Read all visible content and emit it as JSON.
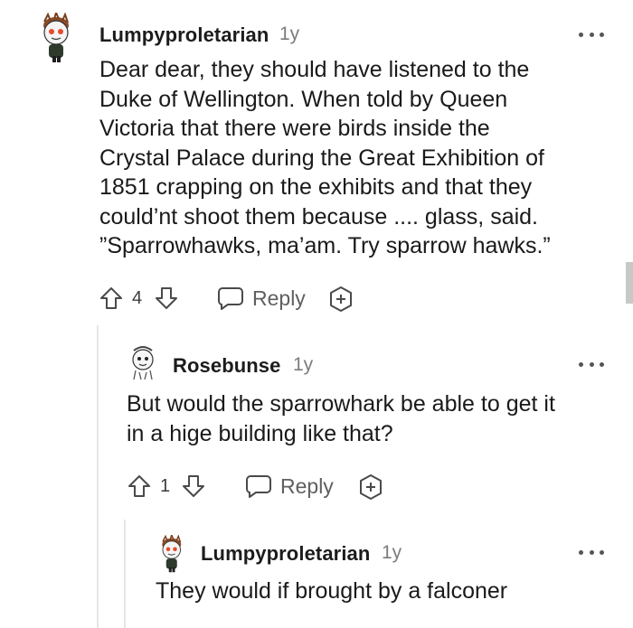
{
  "comments": [
    {
      "username": "Lumpyproletarian",
      "age": "1y",
      "body": "Dear dear, they should have listened to the\nDuke of Wellington. When told by Queen\nVictoria that there were birds inside the\nCrystal Palace during the Great Exhibition of\n1851 crapping on the exhibits and that they\ncould’nt shoot them because .... glass, said.\n”Sparrowhawks, ma’am. Try sparrow hawks.”",
      "votes": "4",
      "reply_label": "Reply"
    },
    {
      "username": "Rosebunse",
      "age": "1y",
      "body": "But would the sparrowhark be able to get it\nin a hige building like that?",
      "votes": "1",
      "reply_label": "Reply"
    },
    {
      "username": "Lumpyproletarian",
      "age": "1y",
      "body": "They would if brought by a falconer"
    }
  ],
  "colors": {
    "text": "#1a1a1b",
    "meta": "#7c7c7c",
    "icon": "#4a4a4a",
    "thread_line": "#e6e6e6"
  }
}
